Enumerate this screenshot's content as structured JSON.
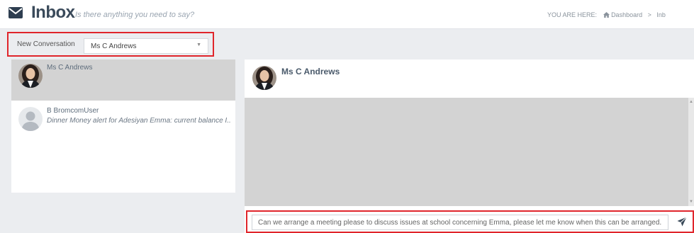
{
  "header": {
    "title": "Inbox",
    "subtitle": "Is there anything you need to say?",
    "breadcrumb": {
      "prefix": "YOU ARE HERE:",
      "home": "Dashboard",
      "separator": ">",
      "current": "Inb"
    }
  },
  "new_conversation": {
    "label": "New Conversation",
    "selected": "Ms C Andrews"
  },
  "conversations": [
    {
      "name": "Ms C Andrews",
      "preview": "",
      "active": true
    },
    {
      "name": "B BromcomUser",
      "preview": "Dinner Money alert for Adesiyan Emma: current balance I..."
    }
  ],
  "chat": {
    "contact_name": "Ms C Andrews",
    "compose_value": "Can we arrange a meeting please to discuss issues at school concerning Emma, please let me know when this can be arranged."
  },
  "icons": {
    "mail": "envelope-icon",
    "home": "home-icon",
    "send": "paper-plane-icon",
    "dropdown": "caret-down-icon"
  },
  "colors": {
    "highlight_border": "#e0252b",
    "active_row": "#d3d3d3",
    "messages_bg": "#d3d3d3",
    "page_bg": "#ebedf0"
  }
}
